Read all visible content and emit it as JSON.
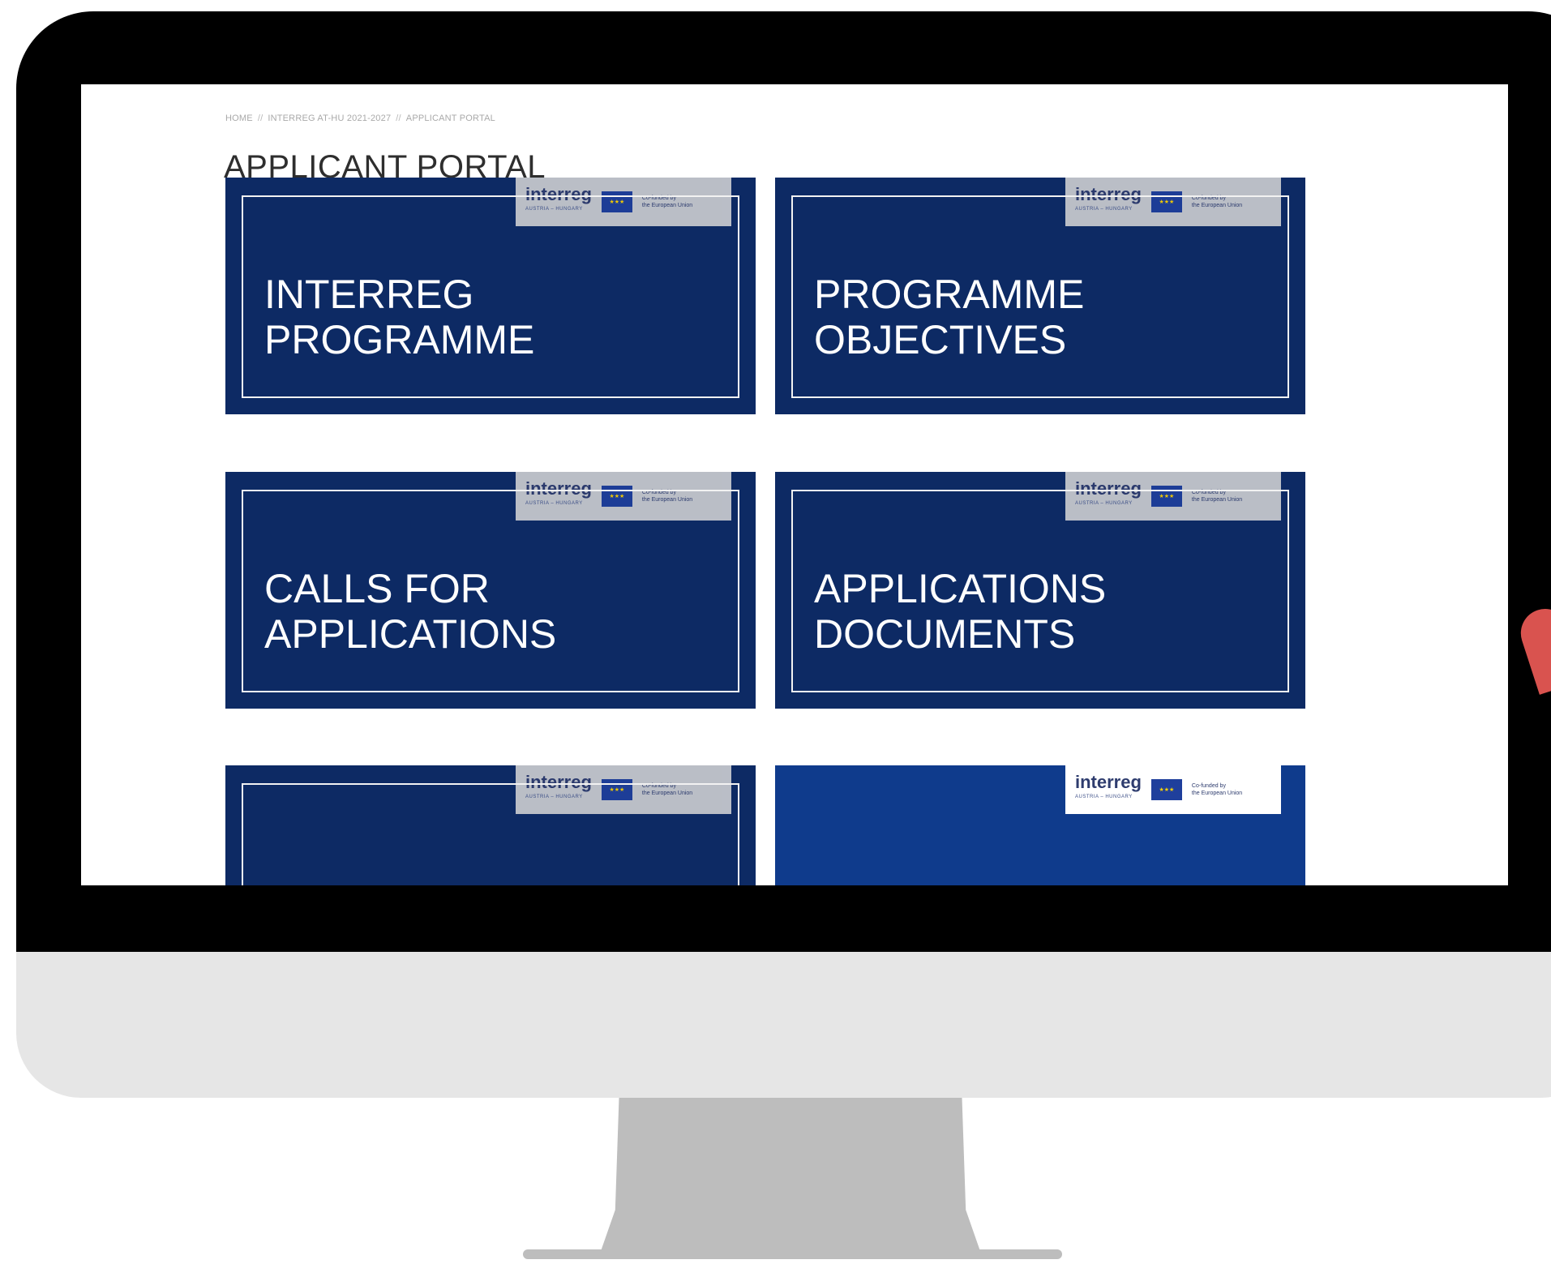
{
  "breadcrumb": {
    "items": [
      "HOME",
      "INTERREG AT-HU 2021-2027",
      "APPLICANT PORTAL"
    ],
    "separator": "//"
  },
  "page": {
    "title": "APPLICANT PORTAL"
  },
  "tiles": [
    {
      "line1": "INTERREG",
      "line2": "PROGRAMME"
    },
    {
      "line1": "PROGRAMME",
      "line2": "OBJECTIVES"
    },
    {
      "line1": "CALLS FOR",
      "line2": "APPLICATIONS"
    },
    {
      "line1": "APPLICATIONS",
      "line2": "DOCUMENTS"
    },
    {
      "line1": "",
      "line2": ""
    },
    {
      "line1": "",
      "line2": ""
    }
  ],
  "logo": {
    "word": "interreg",
    "sub": "AUSTRIA – HUNGARY",
    "eu_text_1": "Co-funded by",
    "eu_text_2": "the European Union"
  },
  "colors": {
    "tile_navy": "#0d2a64",
    "tile_blue": "#0f3b8c",
    "title_text": "#2e2e2e",
    "breadcrumb_text": "#a9a9a9",
    "accent_red": "#d9534f"
  }
}
